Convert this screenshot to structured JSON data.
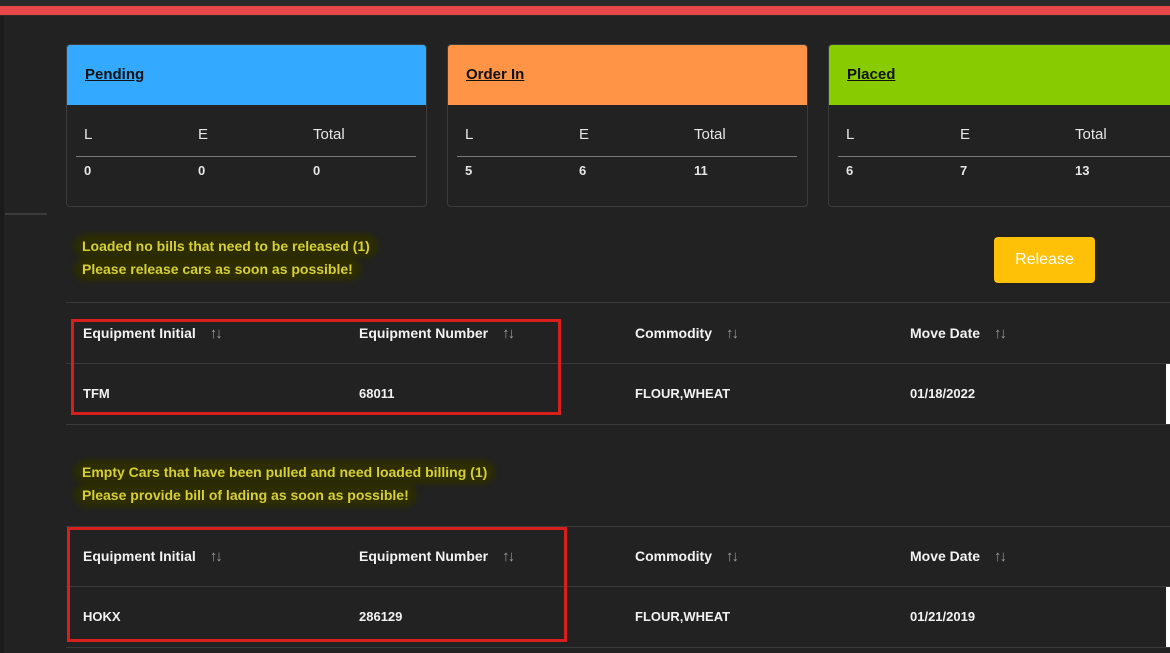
{
  "colors": {
    "accent_bar": "#e8474a",
    "pending": "#33aaff",
    "order_in": "#ff9446",
    "placed": "#88cc00",
    "notice_text": "#d6cf36",
    "release_button": "#ffc107",
    "highlight_box": "#d91e1e"
  },
  "cards": [
    {
      "title": "Pending",
      "headers": [
        "L",
        "E",
        "Total"
      ],
      "values": [
        "0",
        "0",
        "0"
      ]
    },
    {
      "title": "Order In",
      "headers": [
        "L",
        "E",
        "Total"
      ],
      "values": [
        "5",
        "6",
        "11"
      ]
    },
    {
      "title": "Placed",
      "headers": [
        "L",
        "E",
        "Total"
      ],
      "values": [
        "6",
        "7",
        "13"
      ]
    }
  ],
  "section1": {
    "notice_line1": "Loaded no bills that need to be released (1)",
    "notice_line2": "Please release cars as soon as possible!",
    "release_label": "Release",
    "columns": [
      "Equipment Initial",
      "Equipment Number",
      "Commodity",
      "Move Date"
    ],
    "rows": [
      [
        "TFM",
        "68011",
        "FLOUR,WHEAT",
        "01/18/2022"
      ]
    ]
  },
  "section2": {
    "notice_line1": "Empty Cars that have been pulled and need loaded billing (1)",
    "notice_line2": "Please provide bill of lading as soon as possible!",
    "columns": [
      "Equipment Initial",
      "Equipment Number",
      "Commodity",
      "Move Date"
    ],
    "rows": [
      [
        "HOKX",
        "286129",
        "FLOUR,WHEAT",
        "01/21/2019"
      ]
    ]
  },
  "icons": {
    "sort": "sort-arrows-icon",
    "sort_glyph": "↑↓"
  }
}
